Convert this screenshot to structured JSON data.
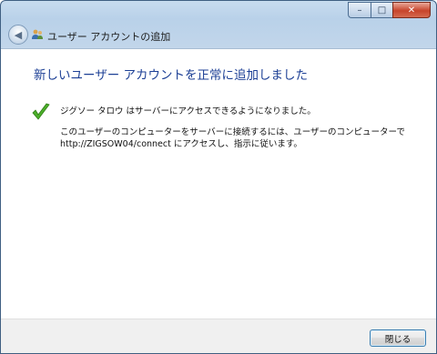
{
  "window": {
    "caption_buttons": {
      "minimize": "–",
      "maximize": "□",
      "close": "✕"
    }
  },
  "navbar": {
    "back_glyph": "◀",
    "title": "ユーザー アカウントの追加",
    "icon": "users-icon"
  },
  "content": {
    "heading": "新しいユーザー アカウントを正常に追加しました",
    "success_icon": "checkmark-icon",
    "message_line1": "ジグソー タロウ はサーバーにアクセスできるようになりました。",
    "message_line2a": "このユーザーのコンピューターをサーバーに接続するには、ユーザーのコンピューターで",
    "message_line2b": "http://ZIGSOW04/connect にアクセスし、指示に従います。"
  },
  "footer": {
    "close_label": "閉じる"
  },
  "colors": {
    "heading": "#1c3f95",
    "check": "#4caf2a",
    "titlebar": "#b9d1e9"
  }
}
